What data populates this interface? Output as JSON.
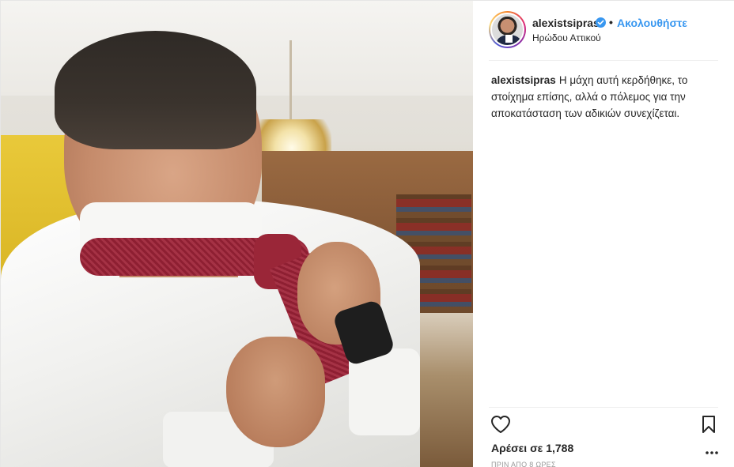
{
  "post": {
    "username": "alexistsipras",
    "verified": true,
    "follow_label": "Ακολουθήστε",
    "separator": "•",
    "location": "Ηρώδου Αττικού",
    "caption_user": "alexistsipras",
    "caption_text": "Η μάχη αυτή κερδήθηκε, το στοίχημα επίσης, αλλά ο πόλεμος για την αποκατάσταση των αδικιών συνεχίζεται.",
    "likes_label": "Αρέσει σε 1,788",
    "timestamp": "ΠΡΙΝ ΑΠΟ 8 ΩΡΕΣ"
  },
  "icons": {
    "like": "heart-icon",
    "save": "bookmark-icon",
    "more": "more-options-icon",
    "verified": "verified-badge-icon"
  },
  "colors": {
    "accent": "#3897f0",
    "text": "#262626",
    "muted": "#999999",
    "tie": "#a53245"
  }
}
